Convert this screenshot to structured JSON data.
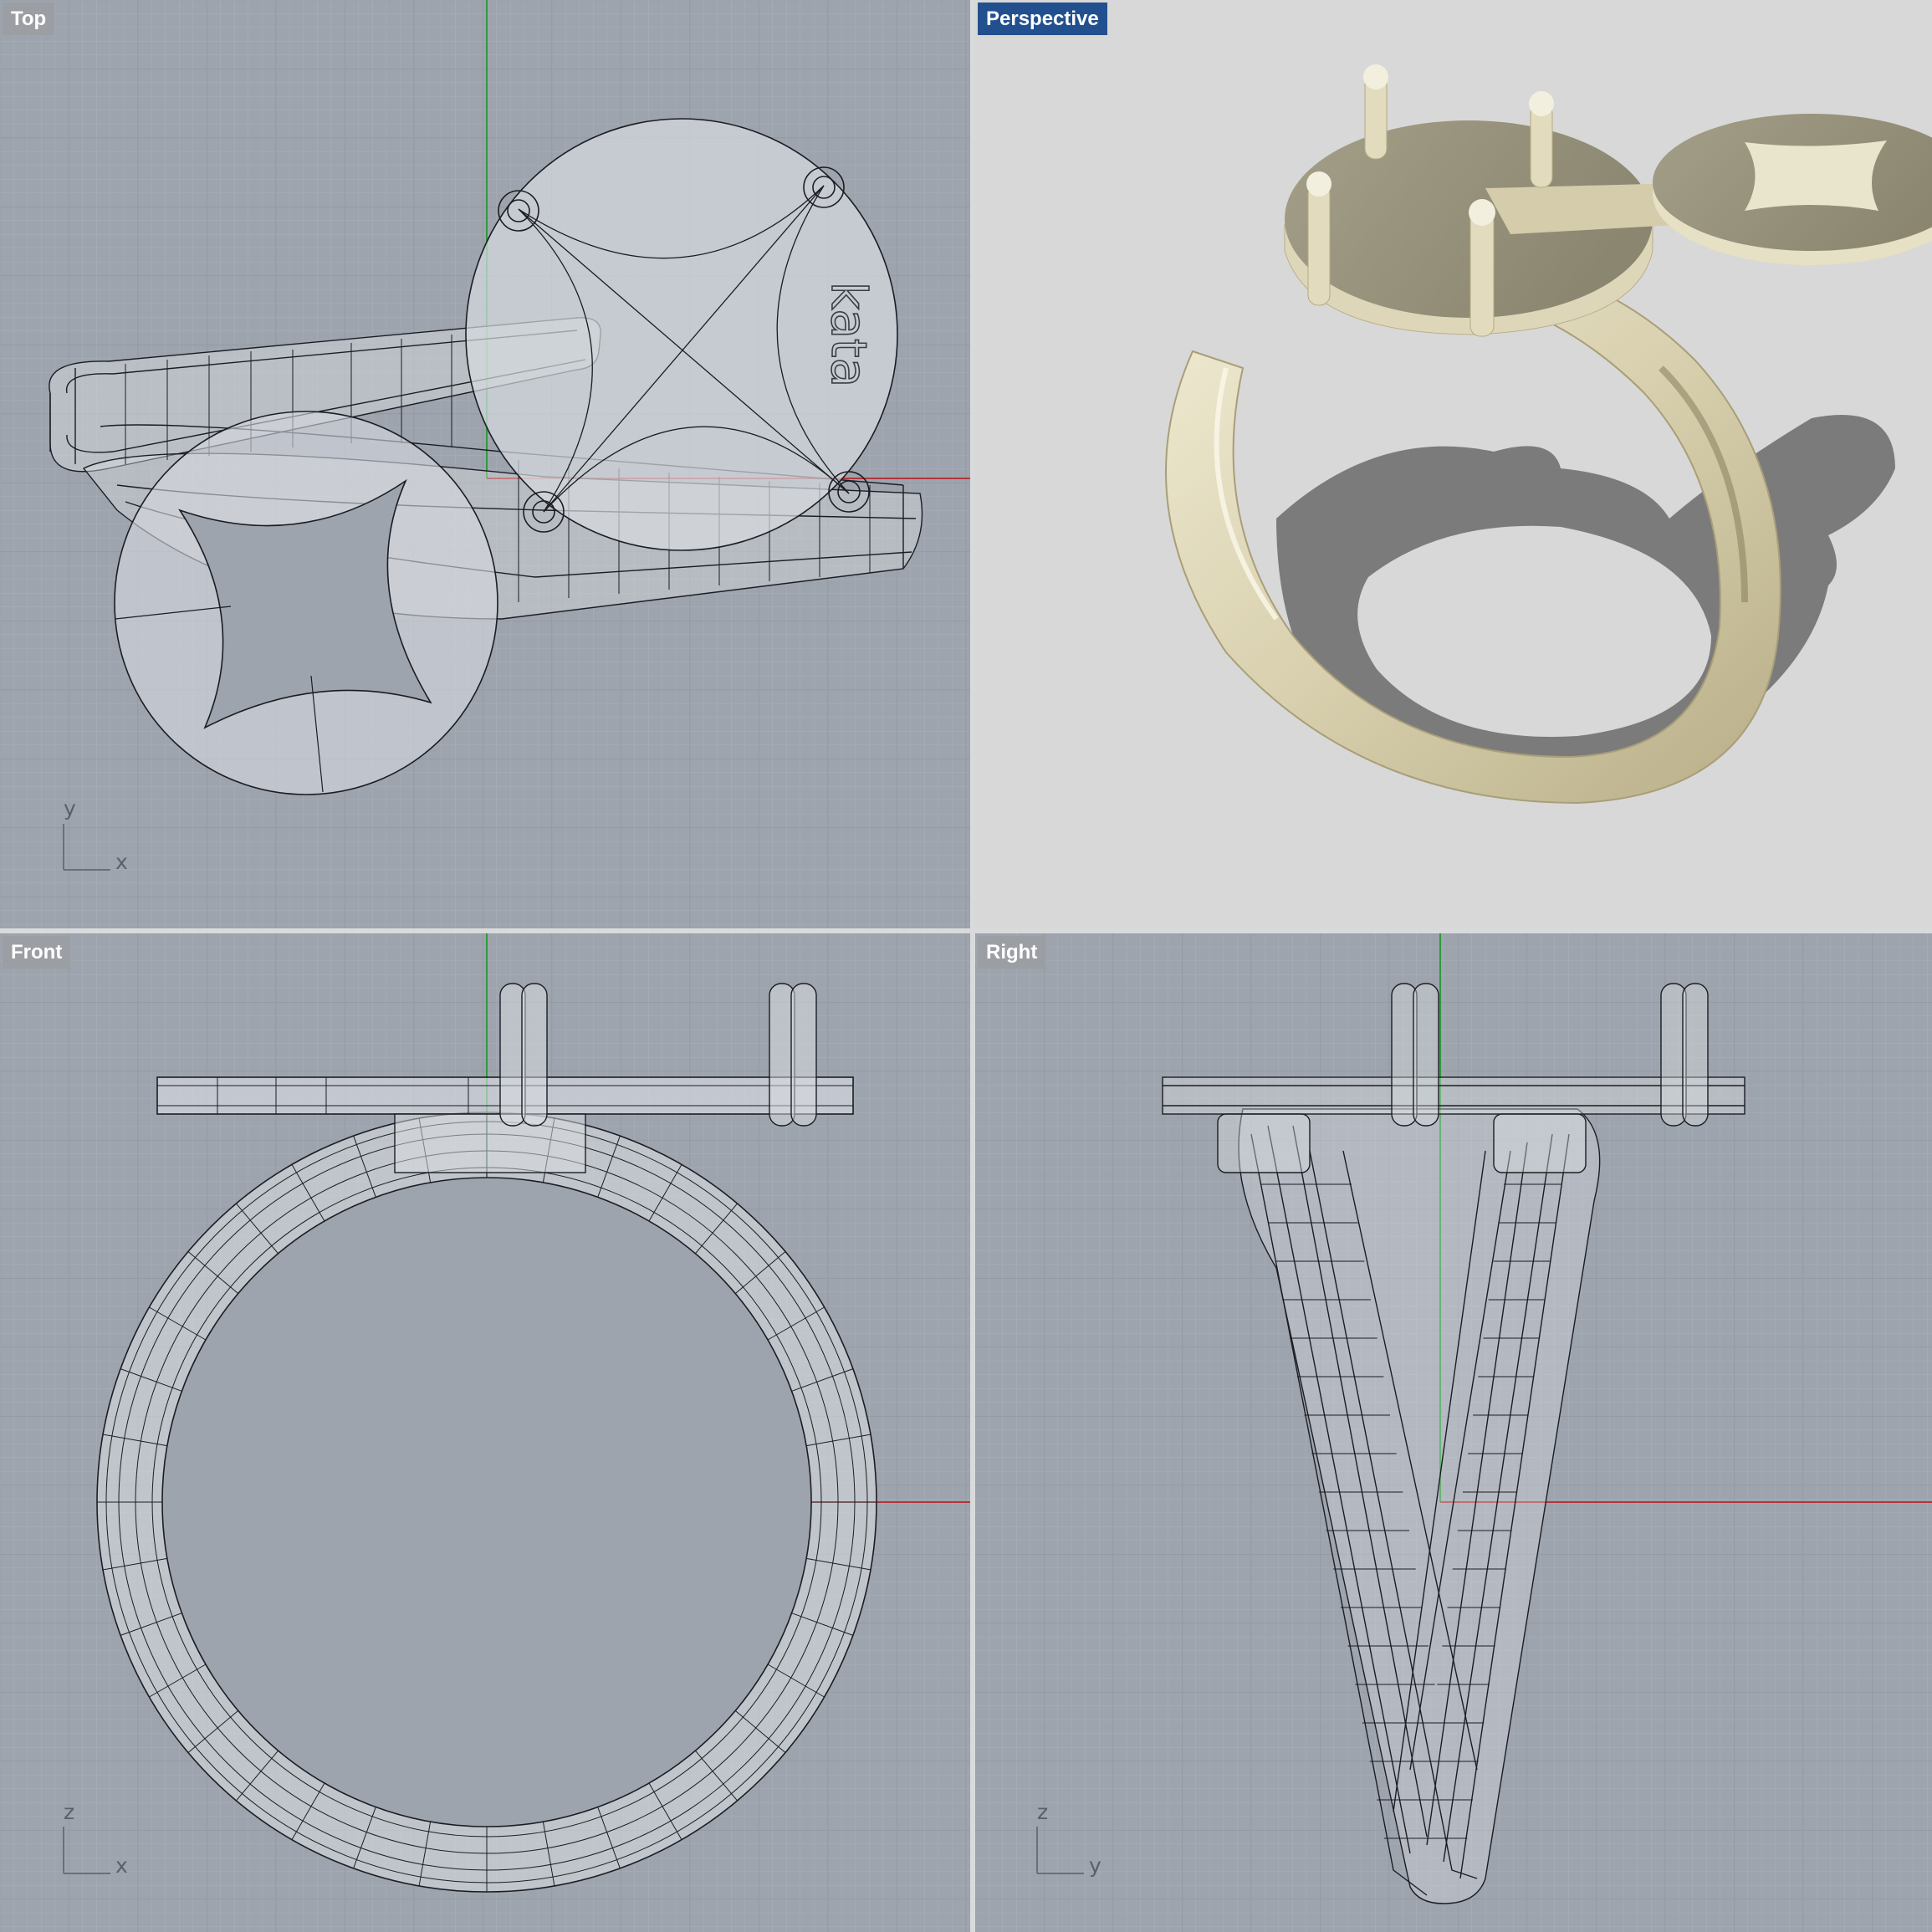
{
  "viewports": [
    {
      "id": "top",
      "label": "Top",
      "active": false,
      "axes": [
        "y",
        "x"
      ]
    },
    {
      "id": "perspective",
      "label": "Perspective",
      "active": true,
      "axes": []
    },
    {
      "id": "front",
      "label": "Front",
      "active": false,
      "axes": [
        "z",
        "x"
      ]
    },
    {
      "id": "right",
      "label": "Right",
      "active": false,
      "axes": [
        "z",
        "y"
      ]
    }
  ],
  "model": {
    "engraving": "kata",
    "material_color": "#e6e0c4"
  },
  "colors": {
    "viewport_bg": "#9ea4ae",
    "grid_minor": "#a8aeb7",
    "grid_major": "#8e949e",
    "x_axis": "#b0373a",
    "y_axis": "#2e9a3c",
    "wire": "#1b1d22",
    "active_label": "#22508f"
  }
}
